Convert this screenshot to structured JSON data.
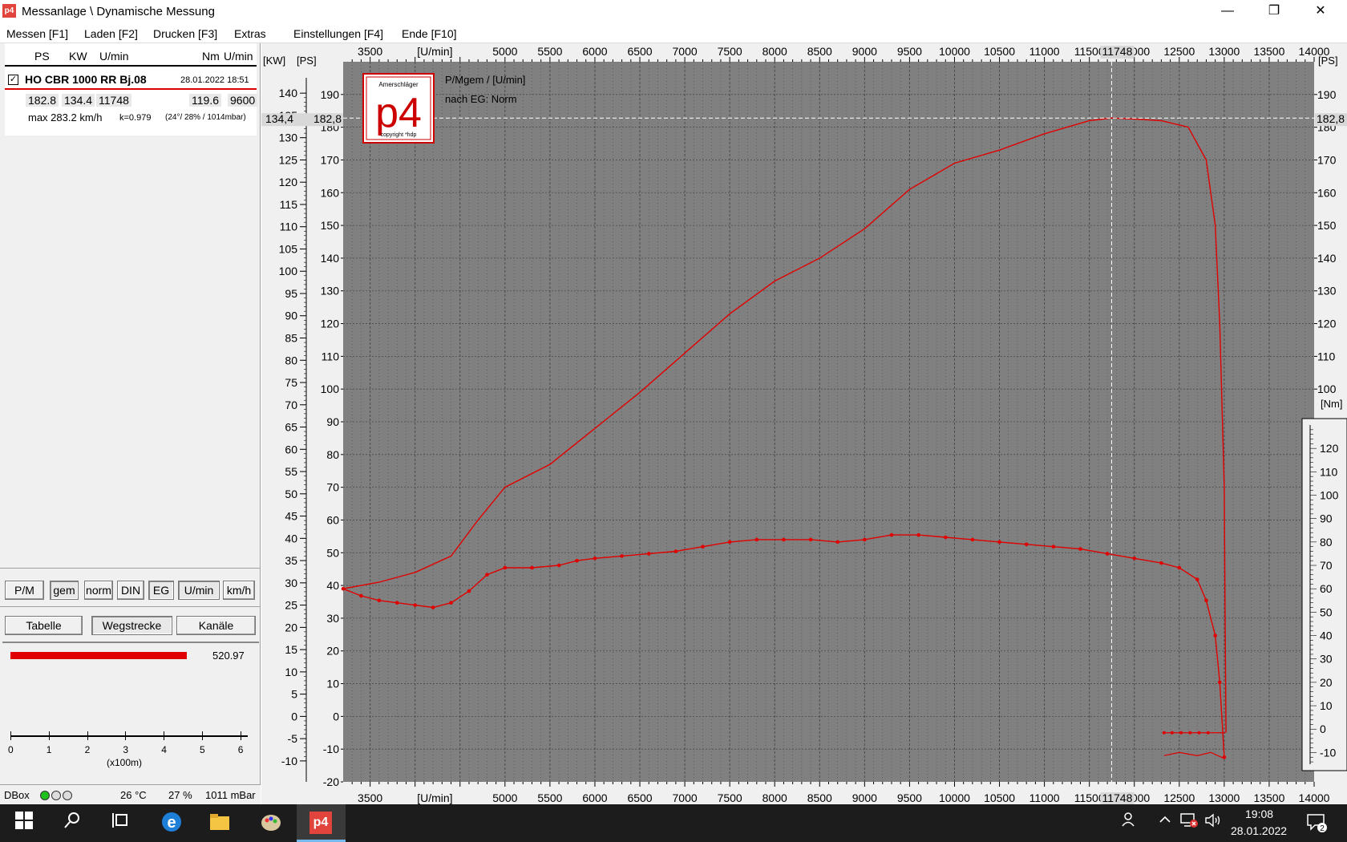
{
  "window": {
    "title": "Messanlage \\ Dynamische Messung",
    "app_icon_text": "p4",
    "minimize": "—",
    "maximize": "❐",
    "close": "✕"
  },
  "menu": [
    "Messen [F1]",
    "Laden [F2]",
    "Drucken [F3]",
    "Extras",
    "Einstellungen [F4]",
    "Ende [F10]"
  ],
  "left_panel": {
    "headers": {
      "ps": "PS",
      "kw": "KW",
      "umin": "U/min",
      "nm": "Nm",
      "umin2": "U/min"
    },
    "run": {
      "checked": "✓",
      "name": "HO CBR 1000 RR Bj.08",
      "date": "28.01.2022 18:51",
      "ps": "182.8",
      "kw": "134.4",
      "umin": "11748",
      "nm": "119.6",
      "nm_umin": "9600",
      "vmax": "max 283.2 km/h",
      "k": "k=0.979",
      "conditions": "(24°/ 28% / 1014mbar)"
    },
    "buttons_row1": [
      "P/M",
      "gem",
      "norm",
      "DIN",
      "EG",
      "U/min",
      "km/h"
    ],
    "buttons_row2": [
      "Tabelle",
      "Wegstrecke",
      "Kanäle"
    ],
    "distance": {
      "value": "520.97",
      "fraction": 0.895,
      "axis_ticks": [
        "0",
        "1",
        "2",
        "3",
        "4",
        "5",
        "6"
      ],
      "axis_unit": "(x100m)"
    },
    "status": {
      "dbox": "DBox",
      "temp": "26 °C",
      "humidity": "27 %",
      "pressure": "1011 mBar"
    }
  },
  "chart": {
    "title": "P/Mgem / [U/min]",
    "subtitle": "nach EG: Norm",
    "logo": {
      "top": "Amerschläger",
      "main": "p4",
      "bottom": "copyright *hdp"
    },
    "x_unit": "[U/min]",
    "unit_kw": "[KW]",
    "unit_ps": "[PS]",
    "unit_ps_right": "[PS]",
    "unit_nm": "[Nm]",
    "cursor": {
      "rpm": "11748",
      "kw": "134,4",
      "ps": "182,8",
      "ps_right": "182,8"
    },
    "colors": {
      "background": "#808080",
      "curve": "#e00000",
      "grid": "#4a4a4a"
    }
  },
  "chart_data": {
    "type": "line",
    "x_ticks": [
      3500,
      5000,
      5500,
      6000,
      6500,
      7000,
      7500,
      8000,
      8500,
      9000,
      9500,
      10000,
      10500,
      11000,
      11500,
      12000,
      12500,
      13000,
      13500,
      14000
    ],
    "xlim": [
      3200,
      14000
    ],
    "ps_ticks": [
      -20,
      -10,
      0,
      10,
      20,
      30,
      40,
      50,
      60,
      70,
      80,
      90,
      100,
      110,
      120,
      130,
      140,
      150,
      160,
      170,
      180,
      190
    ],
    "ps_lim": [
      -20,
      200
    ],
    "kw_ticks": [
      -10,
      -5,
      0,
      5,
      10,
      15,
      20,
      25,
      30,
      35,
      40,
      45,
      50,
      55,
      60,
      65,
      70,
      75,
      80,
      85,
      90,
      95,
      100,
      105,
      110,
      115,
      120,
      125,
      130,
      135,
      140
    ],
    "nm_ticks": [
      -10,
      0,
      10,
      20,
      30,
      40,
      50,
      60,
      70,
      80,
      90,
      100,
      110,
      120
    ],
    "series": [
      {
        "name": "P",
        "x": [
          3200,
          3600,
          4000,
          4400,
          4700,
          5000,
          5500,
          6000,
          6500,
          7000,
          7500,
          8000,
          8500,
          9000,
          9500,
          10000,
          10500,
          11000,
          11500,
          11748,
          12000,
          12300,
          12600,
          12800,
          12900,
          12950,
          13000,
          13010,
          13020
        ],
        "y": [
          39,
          41,
          44,
          49,
          60,
          70,
          77,
          88,
          99,
          111,
          123,
          133,
          140,
          149,
          161,
          169,
          173,
          178,
          182,
          182.8,
          182.5,
          182,
          180,
          170,
          150,
          120,
          70,
          30,
          -5
        ]
      },
      {
        "name": "M",
        "x": [
          3200,
          3400,
          3600,
          3800,
          4000,
          4200,
          4400,
          4600,
          4800,
          5000,
          5300,
          5600,
          5800,
          6000,
          6300,
          6600,
          6900,
          7200,
          7500,
          7800,
          8100,
          8400,
          8700,
          9000,
          9300,
          9600,
          9900,
          10200,
          10500,
          10800,
          11100,
          11400,
          11700,
          12000,
          12300,
          12500,
          12700,
          12800,
          12900,
          12950,
          13000
        ],
        "y": [
          60,
          57,
          55,
          54,
          53,
          52,
          54,
          59,
          66,
          69,
          69,
          70,
          72,
          73,
          74,
          75,
          76,
          78,
          80,
          81,
          81,
          81,
          80,
          81,
          83,
          83,
          82,
          81,
          80,
          79,
          78,
          77,
          75,
          73,
          71,
          69,
          64,
          55,
          40,
          20,
          -12
        ]
      }
    ]
  }
}
